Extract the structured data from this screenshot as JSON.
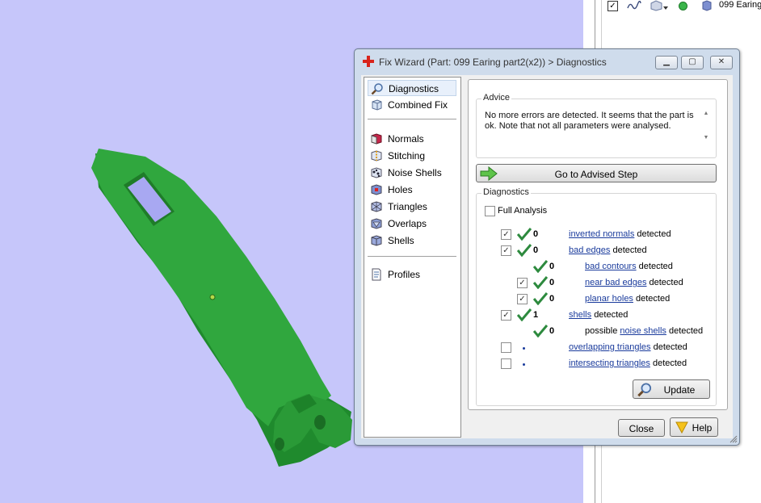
{
  "right_panel": {
    "item_label": "099 Earing"
  },
  "dialog": {
    "title": "Fix Wizard (Part: 099 Earing part2(x2)) > Diagnostics",
    "nav": {
      "group1": [
        "Diagnostics",
        "Combined Fix"
      ],
      "group2": [
        "Normals",
        "Stitching",
        "Noise Shells",
        "Holes",
        "Triangles",
        "Overlaps",
        "Shells"
      ],
      "group3": [
        "Profiles"
      ]
    },
    "advice": {
      "title": "Advice",
      "text": "No more errors are detected. It seems that the part is ok. Note that not all parameters were analysed."
    },
    "go_button": "Go to Advised Step",
    "diagnostics": {
      "title": "Diagnostics",
      "full_analysis": "Full Analysis",
      "detected": "detected",
      "possible": "possible",
      "rows": [
        {
          "count": "0",
          "link": "inverted normals"
        },
        {
          "count": "0",
          "link": "bad edges"
        },
        {
          "count": "0",
          "link": "bad contours"
        },
        {
          "count": "0",
          "link": "near bad edges"
        },
        {
          "count": "0",
          "link": "planar holes"
        },
        {
          "count": "1",
          "link": "shells"
        },
        {
          "count": "0",
          "link": "noise shells"
        },
        {
          "link": "overlapping triangles"
        },
        {
          "link": "intersecting triangles"
        }
      ]
    },
    "update_button": "Update",
    "close_button": "Close",
    "help_button": "Help"
  },
  "colors": {
    "viewport_bg": "#c6c6fa",
    "part_green": "#2fa43c",
    "tick_green": "#2d8a3e",
    "link_blue": "#1a3b9c"
  }
}
